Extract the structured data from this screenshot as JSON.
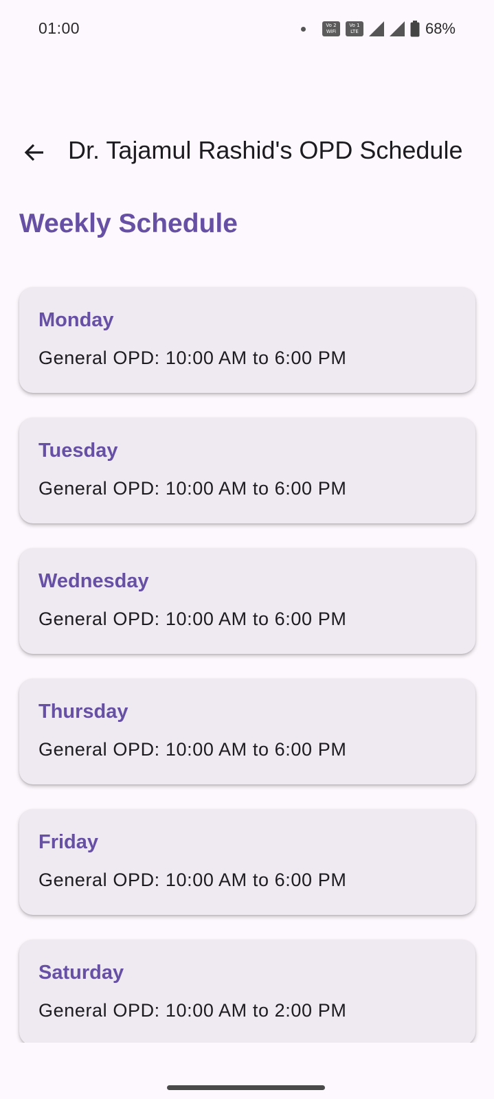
{
  "status_bar": {
    "time": "01:00",
    "sim1_badge_top": "Vo 2",
    "sim1_badge_bottom": "WiFi",
    "sim2_badge_top": "Vo 1",
    "sim2_badge_bottom": "LTE",
    "battery_percent": "68%"
  },
  "app_bar": {
    "back_icon": "arrow-back-icon",
    "title": "Dr. Tajamul Rashid's OPD Schedule"
  },
  "section": {
    "title": "Weekly Schedule"
  },
  "schedule": [
    {
      "day": "Monday",
      "hours": "General OPD: 10:00 AM to 6:00 PM"
    },
    {
      "day": "Tuesday",
      "hours": "General OPD: 10:00 AM to 6:00 PM"
    },
    {
      "day": "Wednesday",
      "hours": "General OPD: 10:00 AM to 6:00 PM"
    },
    {
      "day": "Thursday",
      "hours": "General OPD: 10:00 AM to 6:00 PM"
    },
    {
      "day": "Friday",
      "hours": "General OPD: 10:00 AM to 6:00 PM"
    },
    {
      "day": "Saturday",
      "hours": "General OPD: 10:00 AM to 2:00 PM"
    }
  ],
  "colors": {
    "accent": "#6650a4",
    "card_background": "#efe9f1",
    "page_background": "#fdf8fd"
  }
}
